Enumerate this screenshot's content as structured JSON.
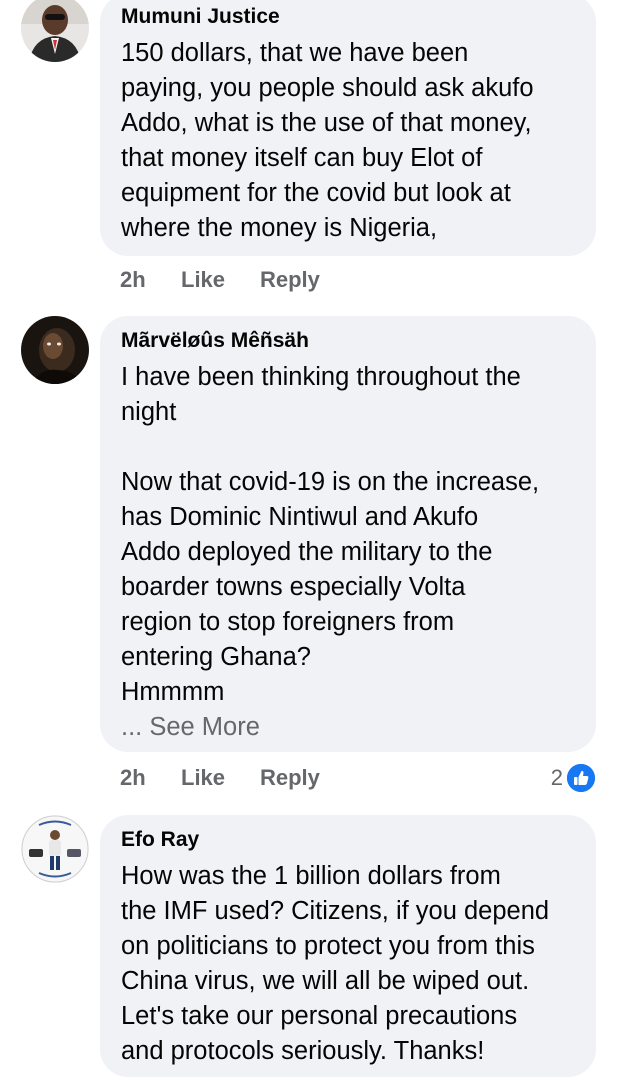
{
  "comments": [
    {
      "author": "Mumuni Justice",
      "text": "150 dollars, that we have been\npaying, you people should ask akufo\nAddo, what is the use of that money,\nthat money itself can buy Elot of\nequipment for the covid but look at\nwhere the money is Nigeria,",
      "time": "2h",
      "like_label": "Like",
      "reply_label": "Reply",
      "avatar_icon": "profile-photo-man-suit-icon"
    },
    {
      "author": "Mãrvëløûs Mêñsäh",
      "text": "I have been thinking throughout the\nnight\n\nNow that covid-19 is on the increase,\nhas Dominic Nintiwul and Akufo\nAddo deployed the military to the\nboarder towns especially Volta\nregion to stop foreigners from\nentering Ghana?\nHmmmm",
      "see_more": "... See More",
      "time": "2h",
      "like_label": "Like",
      "reply_label": "Reply",
      "reaction_count": "2",
      "reaction_icon": "like-reaction-icon",
      "avatar_icon": "profile-photo-dark-portrait-icon"
    },
    {
      "author": "Efo Ray",
      "text": "How was the 1 billion dollars from\nthe IMF used? Citizens, if you depend\non politicians to protect you from this\nChina virus, we will all be wiped out.\nLet's take our personal precautions\nand protocols seriously. Thanks!",
      "avatar_icon": "profile-photo-man-standing-icon"
    }
  ],
  "colors": {
    "bubble_bg": "#f0f2f5",
    "text": "#050505",
    "meta": "#65676b",
    "like_blue": "#1877f2"
  }
}
